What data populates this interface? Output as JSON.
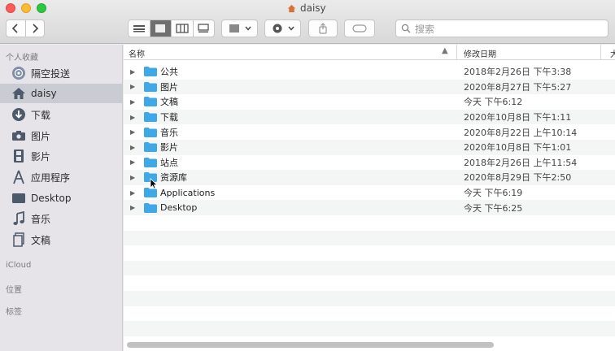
{
  "window": {
    "title": "daisy"
  },
  "toolbar": {
    "back_icon": "chevron-left",
    "forward_icon": "chevron-right",
    "search_placeholder": "搜索"
  },
  "sidebar": {
    "favorites_heading": "个人收藏",
    "items": [
      {
        "label": "隔空投送",
        "icon": "airdrop-icon"
      },
      {
        "label": "daisy",
        "icon": "home-icon",
        "selected": true
      },
      {
        "label": "下载",
        "icon": "download-icon"
      },
      {
        "label": "图片",
        "icon": "pictures-icon"
      },
      {
        "label": "影片",
        "icon": "movies-icon"
      },
      {
        "label": "应用程序",
        "icon": "applications-icon"
      },
      {
        "label": "Desktop",
        "icon": "desktop-icon"
      },
      {
        "label": "音乐",
        "icon": "music-icon"
      },
      {
        "label": "文稿",
        "icon": "documents-icon"
      }
    ],
    "icloud_heading": "iCloud",
    "locations_heading": "位置",
    "tags_heading": "标签"
  },
  "list": {
    "columns": {
      "name": "名称",
      "date": "修改日期",
      "size": "大"
    },
    "rows": [
      {
        "name": "公共",
        "date": "2018年2月26日 下午3:38"
      },
      {
        "name": "图片",
        "date": "2020年8月27日 下午5:27"
      },
      {
        "name": "文稿",
        "date": "今天 下午6:12"
      },
      {
        "name": "下载",
        "date": "2020年10月8日 下午1:11"
      },
      {
        "name": "音乐",
        "date": "2020年8月22日 上午10:14"
      },
      {
        "name": "影片",
        "date": "2020年10月8日 下午1:01"
      },
      {
        "name": "站点",
        "date": "2018年2月26日 上午11:54"
      },
      {
        "name": "资源库",
        "date": "2020年8月29日 下午2:50"
      },
      {
        "name": "Applications",
        "date": "今天 下午6:19"
      },
      {
        "name": "Desktop",
        "date": "今天 下午6:25"
      }
    ]
  },
  "colors": {
    "folder": "#3fa8e6",
    "sidebar_bg": "#e6e4e8",
    "selected_row": "#c9ccd3"
  }
}
